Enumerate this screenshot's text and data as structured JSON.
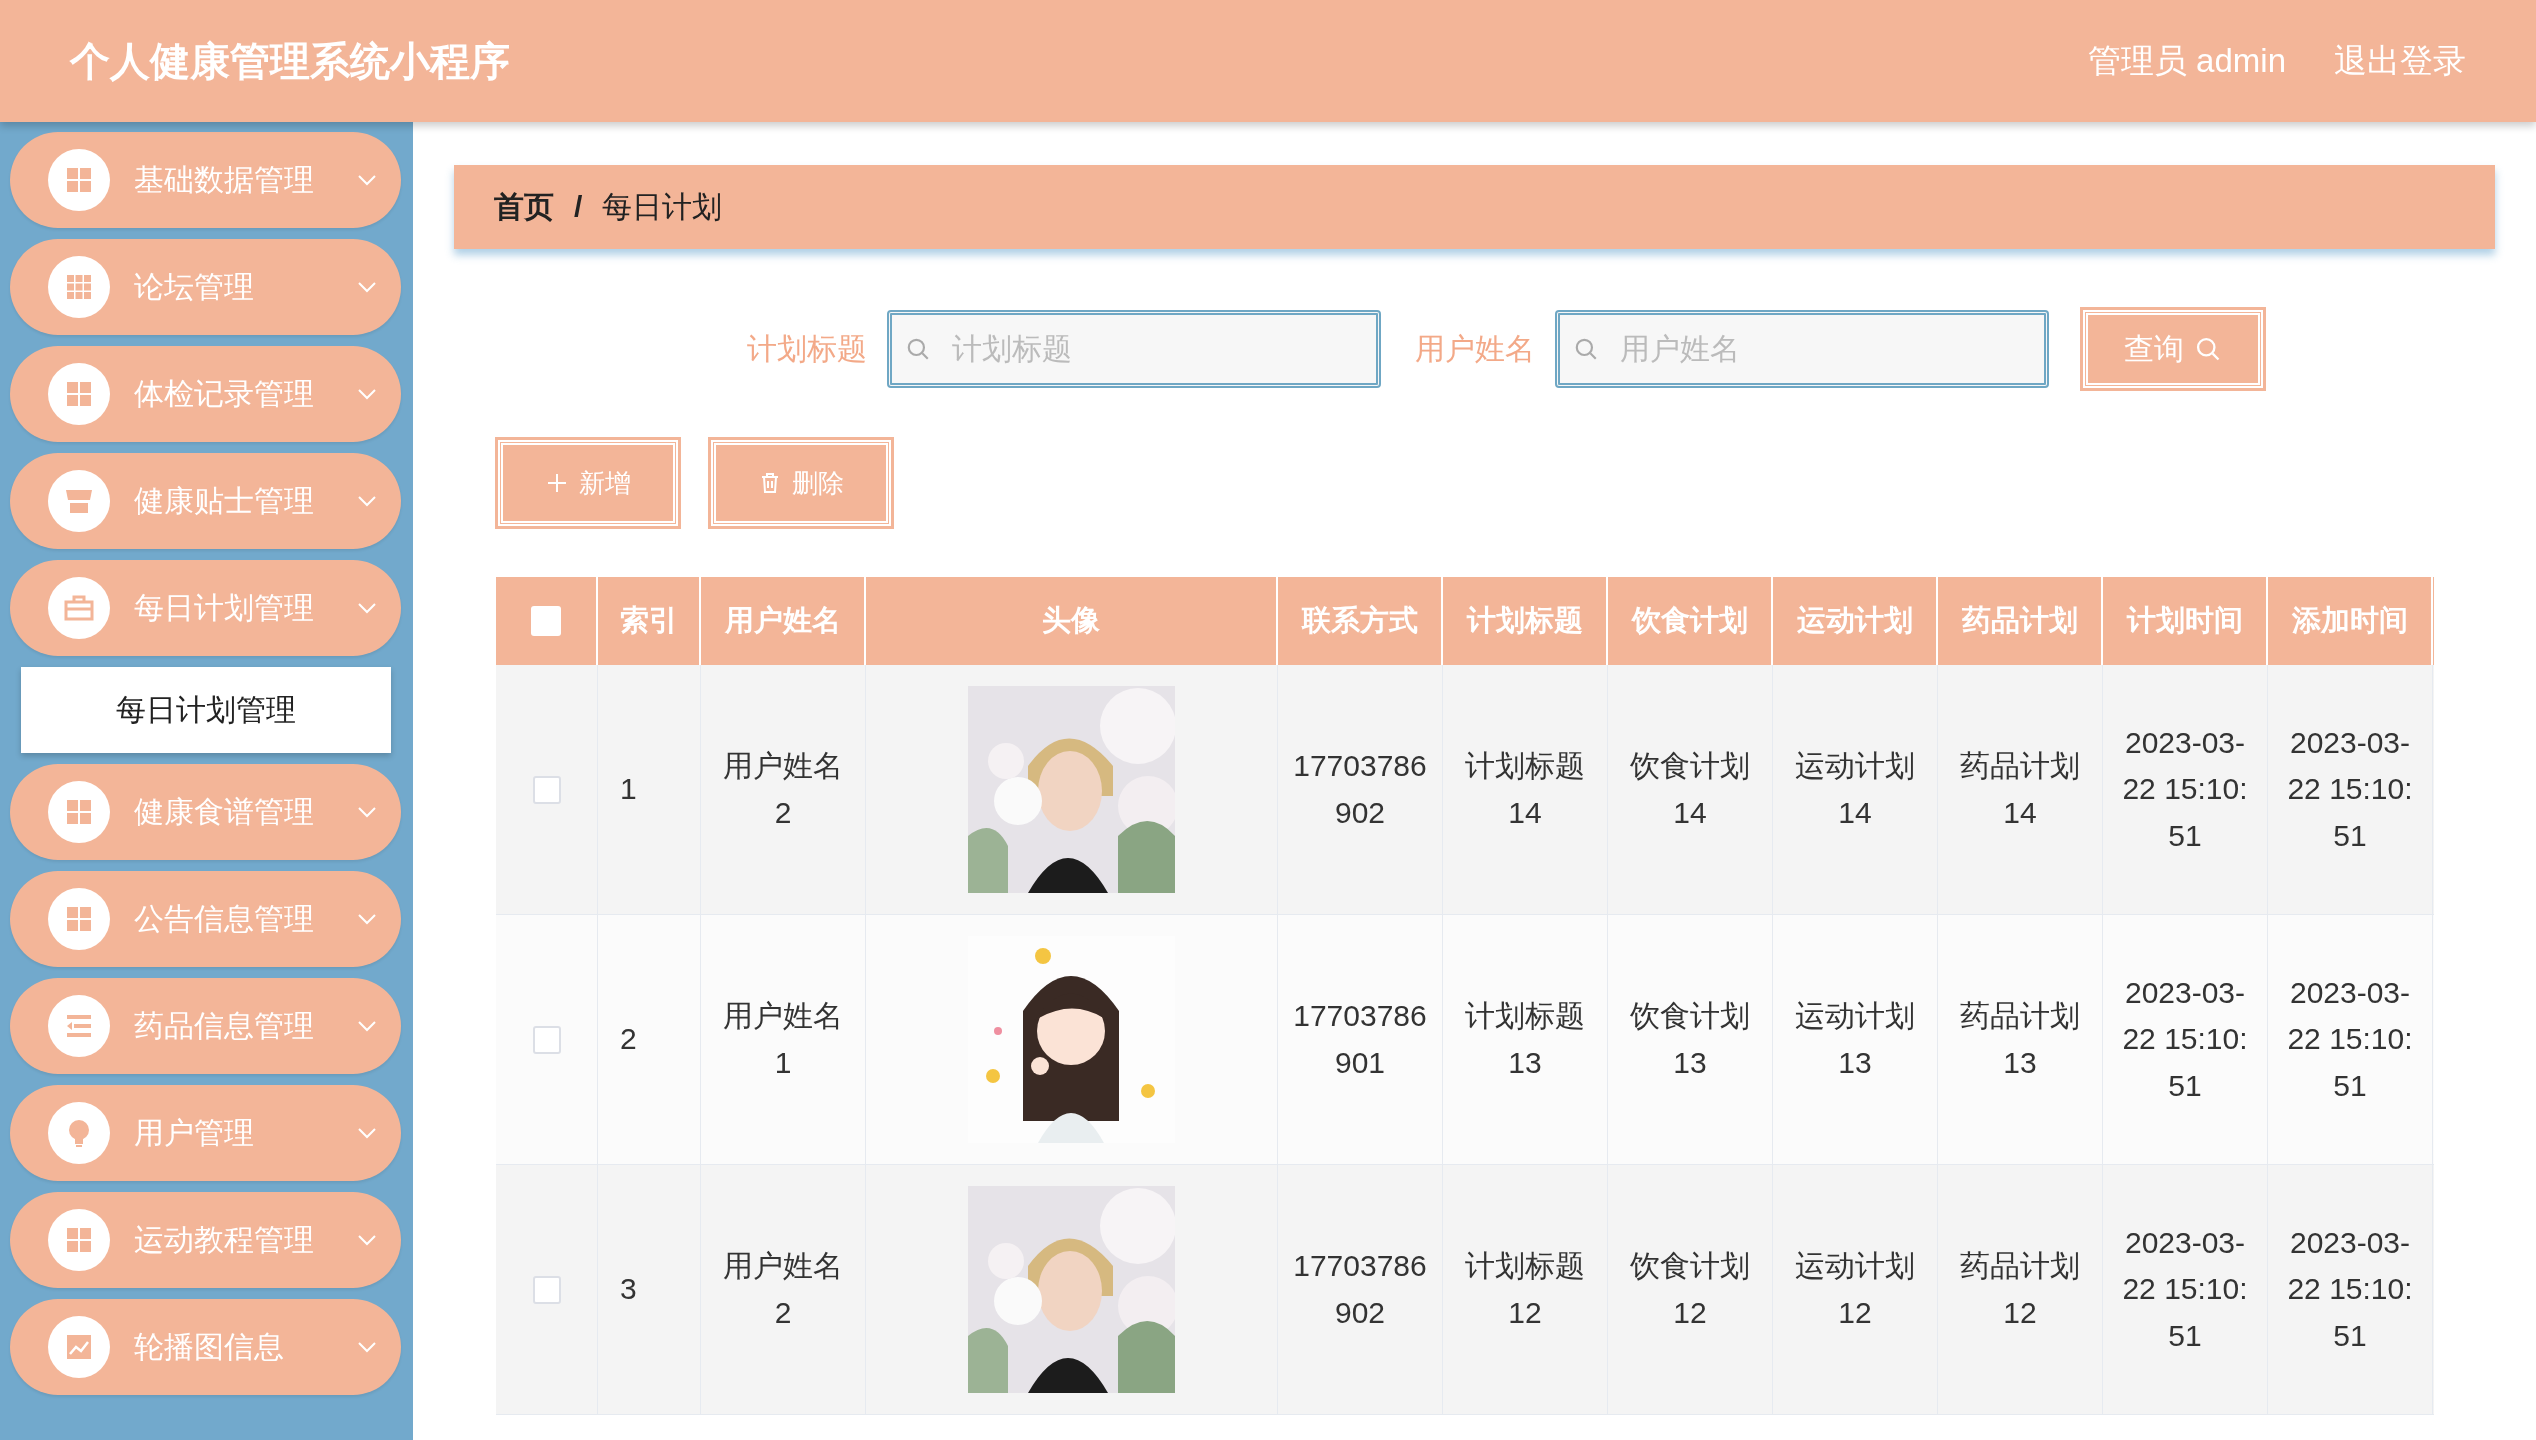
{
  "header": {
    "title": "个人健康管理系统小程序",
    "user": "管理员 admin",
    "logout": "退出登录"
  },
  "sidebar": {
    "items": [
      {
        "label": "基础数据管理",
        "kind": "grid"
      },
      {
        "label": "论坛管理",
        "kind": "table"
      },
      {
        "label": "体检记录管理",
        "kind": "grid"
      },
      {
        "label": "健康贴士管理",
        "kind": "shop"
      },
      {
        "label": "每日计划管理",
        "kind": "briefcase",
        "children": [
          {
            "label": "每日计划管理",
            "selected": true
          }
        ]
      },
      {
        "label": "健康食谱管理",
        "kind": "grid"
      },
      {
        "label": "公告信息管理",
        "kind": "grid"
      },
      {
        "label": "药品信息管理",
        "kind": "list"
      },
      {
        "label": "用户管理",
        "kind": "bulb"
      },
      {
        "label": "运动教程管理",
        "kind": "grid"
      },
      {
        "label": "轮播图信息",
        "kind": "chart"
      }
    ]
  },
  "breadcrumb": {
    "items": [
      "首页",
      "每日计划"
    ],
    "separator": "/"
  },
  "search": {
    "fields": [
      {
        "label": "计划标题",
        "placeholder": "计划标题"
      },
      {
        "label": "用户姓名",
        "placeholder": "用户姓名"
      }
    ],
    "button": "查询"
  },
  "actions": [
    {
      "kind": "add",
      "label": "新增"
    },
    {
      "kind": "delete",
      "label": "删除"
    }
  ],
  "table": {
    "all_checked": false,
    "columns": [
      "索引",
      "用户姓名",
      "头像",
      "联系方式",
      "计划标题",
      "饮食计划",
      "运动计划",
      "药品计划",
      "计划时间",
      "添加时间"
    ],
    "rows": [
      {
        "checked": false,
        "index": "1",
        "name": "用户姓名2",
        "phone": "17703786902",
        "title": "计划标题14",
        "diet": "饮食计划14",
        "sport": "运动计划14",
        "medicine": "药品计划14",
        "plan_time": "2023-03-22 15:10:51",
        "added": "2023-03-22 15:10:51"
      },
      {
        "checked": false,
        "index": "2",
        "name": "用户姓名1",
        "phone": "17703786901",
        "title": "计划标题13",
        "diet": "饮食计划13",
        "sport": "运动计划13",
        "medicine": "药品计划13",
        "plan_time": "2023-03-22 15:10:51",
        "added": "2023-03-22 15:10:51"
      },
      {
        "checked": false,
        "index": "3",
        "name": "用户姓名2",
        "phone": "17703786902",
        "title": "计划标题12",
        "diet": "饮食计划12",
        "sport": "运动计划12",
        "medicine": "药品计划12",
        "plan_time": "2023-03-22 15:10:51",
        "added": "2023-03-22 15:10:51"
      }
    ]
  }
}
